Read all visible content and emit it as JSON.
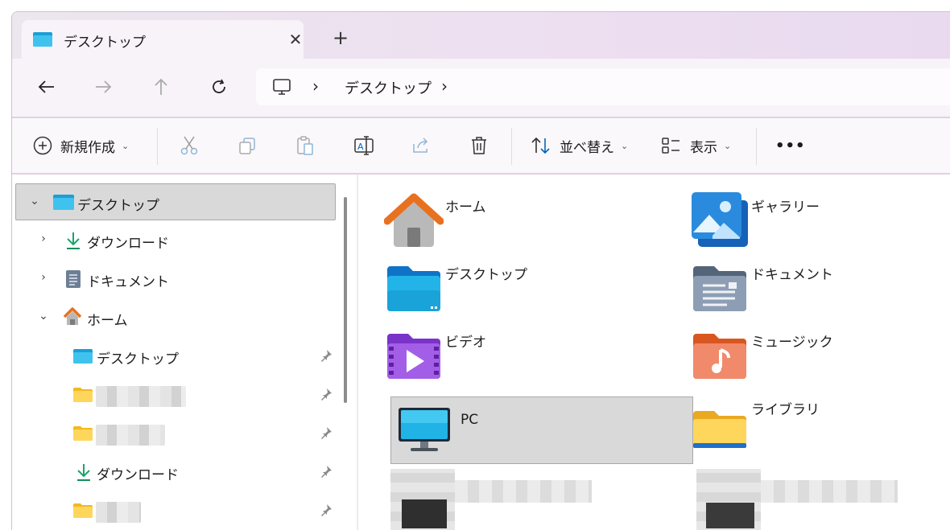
{
  "tab": {
    "title": "デスクトップ",
    "close": "✕",
    "new": "+"
  },
  "address": {
    "location": "デスクトップ",
    "separator": "›"
  },
  "commands": {
    "new_label": "新規作成",
    "sort_label": "並べ替え",
    "view_label": "表示",
    "more": "•••"
  },
  "sidebar": {
    "items": [
      {
        "label": "デスクトップ",
        "icon": "desktop-folder-icon"
      },
      {
        "label": "ダウンロード",
        "icon": "download-icon"
      },
      {
        "label": "ドキュメント",
        "icon": "document-icon"
      },
      {
        "label": "ホーム",
        "icon": "home-icon"
      },
      {
        "label": "デスクトップ",
        "icon": "desktop-folder-icon"
      },
      {
        "label": "ダウンロード",
        "icon": "download-icon"
      }
    ]
  },
  "main": {
    "items": [
      {
        "label": "ホーム",
        "icon": "home-icon"
      },
      {
        "label": "ギャラリー",
        "icon": "gallery-icon"
      },
      {
        "label": "デスクトップ",
        "icon": "desktop-folder-icon"
      },
      {
        "label": "ドキュメント",
        "icon": "documents-folder-icon"
      },
      {
        "label": "ビデオ",
        "icon": "videos-folder-icon"
      },
      {
        "label": "ミュージック",
        "icon": "music-folder-icon"
      },
      {
        "label": "PC",
        "icon": "pc-icon"
      },
      {
        "label": "ライブラリ",
        "icon": "libraries-folder-icon"
      }
    ]
  },
  "colors": {
    "accent": "#0067c0",
    "selected_bg": "#d9d9d9",
    "folder_yellow": "#f7c744"
  }
}
